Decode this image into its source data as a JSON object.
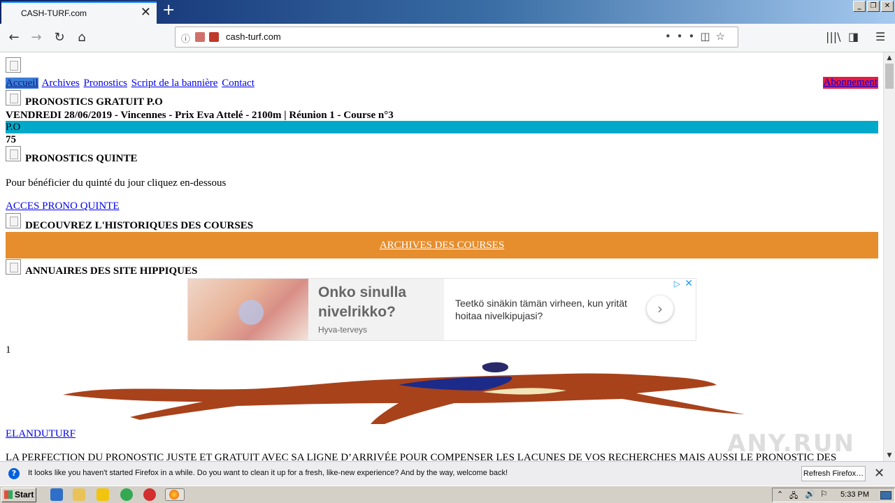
{
  "browser": {
    "tab_title": "CASH-TURF.com",
    "url": "cash-turf.com",
    "url_actions": "•••"
  },
  "page": {
    "menu": {
      "items": [
        "Accueil",
        "Archives",
        "Pronostics",
        "Script de la bannière",
        "Contact"
      ],
      "abonnement": "Abonnement"
    },
    "section_po_title": "PRONOSTICS GRATUIT P.O",
    "race_info": "VENDREDI 28/06/2019 - Vincennes - Prix Eva Attelé - 2100m | Réunion 1 - Course n°3",
    "po_label": "P.O",
    "po_value": "75",
    "section_quinte_title": "PRONOSTICS QUINTE",
    "quinte_text": "Pour bénéficier du quinté du jour cliquez en-dessous",
    "quinte_link": "ACCES PRONO QUINTE",
    "section_history_title": "DECOUVREZ L'HISTORIQUES DES COURSES",
    "archives_button": "ARCHIVES DES COURSES",
    "section_annuaire_title": "ANNUAIRES DES SITE HIPPIQUES",
    "ad": {
      "title": "Onko sinulla nivelrikko?",
      "source": "Hyva-terveys",
      "body": "Teetkö sinäkin tämän virheen, kun yrität hoitaa nivelkipujasi?"
    },
    "annuaire_index": "1",
    "elanduturf_link": "ELANDUTURF",
    "bottom_text": "LA PERFECTION DU PRONOSTIC JUSTE ET GRATUIT AVEC SA LIGNE D’ARRIVÉE POUR COMPENSER LES LACUNES DE VOS RECHERCHES MAIS AUSSI LE PRONOSTIC DES"
  },
  "notification": {
    "text": "It looks like you haven't started Firefox in a while. Do you want to clean it up for a fresh, like-new experience? And by the way, welcome back!",
    "button": "Refresh Firefox…"
  },
  "taskbar": {
    "start": "Start",
    "time": "5:33 PM"
  },
  "watermark": "ANY.RUN"
}
